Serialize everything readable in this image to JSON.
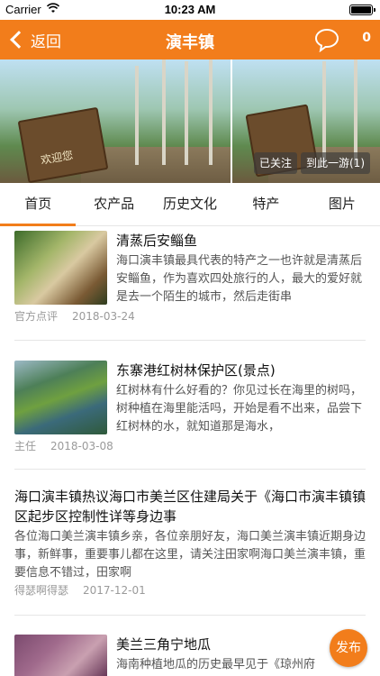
{
  "status_bar": {
    "carrier": "Carrier",
    "time": "10:23 AM"
  },
  "nav": {
    "back_label": "返回",
    "title": "演丰镇",
    "badge_count": "0"
  },
  "banner": {
    "sign_text": "欢迎您",
    "follow_label": "已关注",
    "visit_label": "到此一游(1)"
  },
  "tabs": [
    {
      "label": "首页"
    },
    {
      "label": "农产品"
    },
    {
      "label": "历史文化"
    },
    {
      "label": "特产"
    },
    {
      "label": "图片"
    }
  ],
  "items": [
    {
      "title": "清蒸后安鲻鱼",
      "excerpt": "海口演丰镇最具代表的特产之一也许就是清蒸后安鲻鱼，作为喜欢四处旅行的人，最大的爱好就是去一个陌生的城市，然后走街串",
      "author": "官方点评",
      "date": "2018-03-24"
    },
    {
      "title": "东寨港红树林保护区(景点)",
      "excerpt": "红树林有什么好看的？你见过长在海里的树吗，树种植在海里能活吗，开始是看不出来，品尝下红树林的水，就知道那是海水，",
      "author": "主任",
      "date": "2018-03-08"
    },
    {
      "title": "海口演丰镇热议海口市美兰区住建局关于《海口市演丰镇镇区起步区控制性详等身边事",
      "excerpt": "各位海口美兰演丰镇乡亲，各位亲朋好友，海口美兰演丰镇近期身边事，新鲜事，重要事儿都在这里，请关注田家啊海口美兰演丰镇，重要信息不错过，田家啊",
      "author": "得瑟啊得瑟",
      "date": "2017-12-01"
    },
    {
      "title": "美兰三角宁地瓜",
      "excerpt": "海南种植地瓜的历史最早见于《琼州府"
    }
  ],
  "fab_label": "发布",
  "colors": {
    "accent": "#f27d1b"
  }
}
